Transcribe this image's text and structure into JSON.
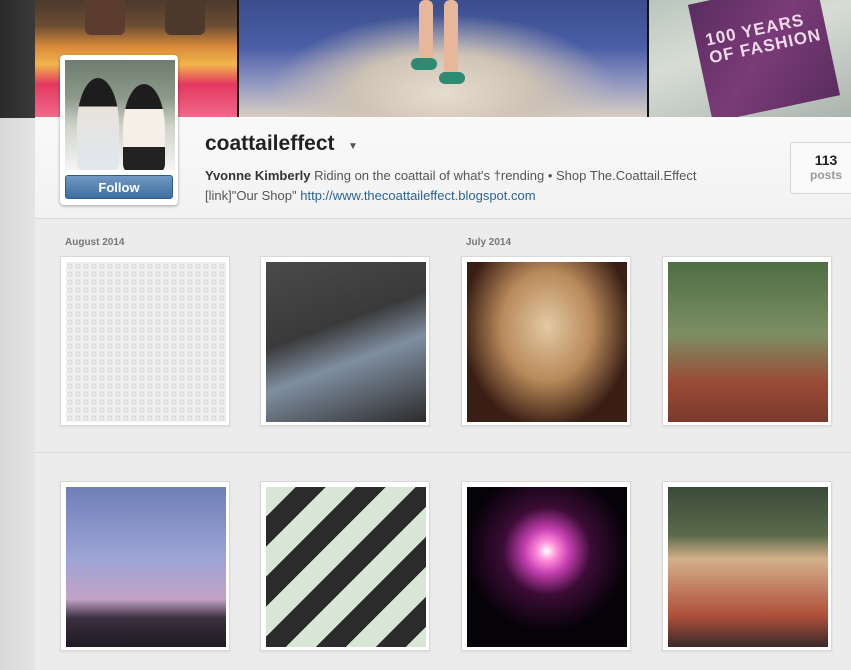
{
  "profile": {
    "username": "coattaileffect",
    "follow_label": "Follow",
    "bio_names": "Yvonne  Kimberly",
    "bio_text": "Riding on the coattail of what's †rending • Shop The.Coattail.Effect",
    "bio_link_prefix": "[link]\"Our Shop\"",
    "bio_url": "http://www.thecoattaileffect.blogspot.com",
    "posts_count": "113",
    "posts_label": "posts"
  },
  "cover": {
    "book_text": "100 YEARS OF FASHION"
  },
  "grid": {
    "months": [
      "August 2014",
      "July 2014"
    ],
    "photos": [
      {
        "icon": "necklace-photo"
      },
      {
        "icon": "watch-shoes-photo"
      },
      {
        "icon": "statement-necklace-photo"
      },
      {
        "icon": "ankle-boots-photo"
      },
      {
        "icon": "moon-crowd-photo"
      },
      {
        "icon": "drink-bottle-photo"
      },
      {
        "icon": "fireworks-photo"
      },
      {
        "icon": "selfie-photo"
      }
    ]
  },
  "colors": {
    "follow_button": "#3f6f9f",
    "link": "#2a6496",
    "background": "#ececec"
  }
}
